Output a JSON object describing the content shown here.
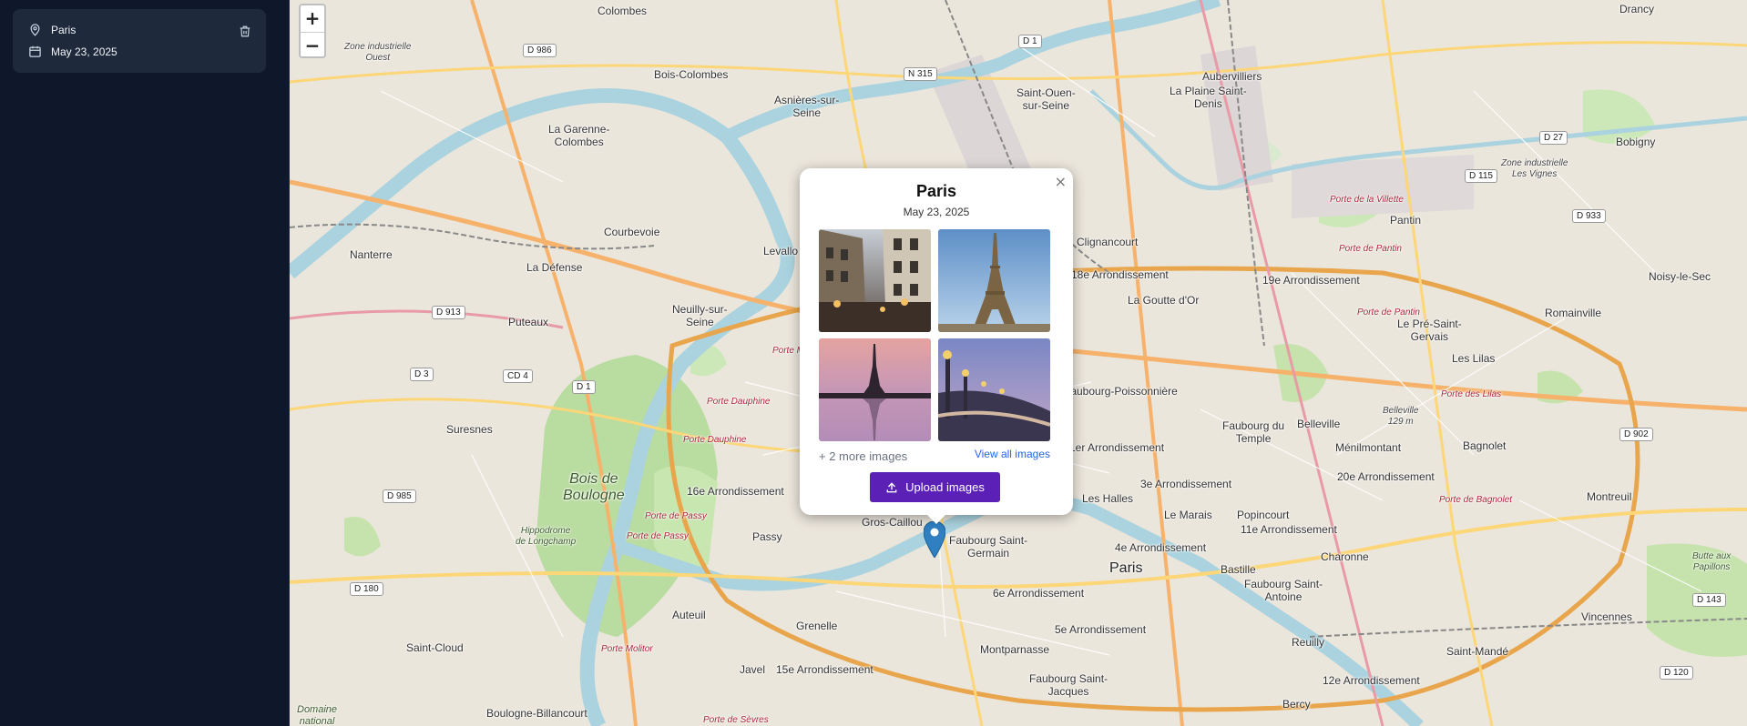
{
  "sidebar": {
    "trip": {
      "location": "Paris",
      "date": "May 23, 2025"
    },
    "icons": {
      "location": "map-pin-icon",
      "date": "calendar-icon",
      "delete": "trash-icon"
    }
  },
  "map": {
    "zoom_in": "+",
    "zoom_out": "−",
    "places": {
      "colombes": "Colombes",
      "bois_colombes": "Bois-Colombes",
      "asnieres": "Asnières-sur-\nSeine",
      "garenne": "La Garenne-\nColombes",
      "courbevoie": "Courbevoie",
      "nanterre": "Nanterre",
      "la_defense": "La Défense",
      "puteaux": "Puteaux",
      "neuilly": "Neuilly-sur-\nSeine",
      "levallois": "Levallo",
      "suresnes": "Suresnes",
      "bois_boulogne": "Bois de\nBoulogne",
      "hippodrome": "Hippodrome\nde Longchamp",
      "arr16": "16e Arrondissement",
      "passy": "Passy",
      "auteuil": "Auteuil",
      "grenelle": "Grenelle",
      "javel": "Javel",
      "arr15": "15e Arrondissement",
      "saint_cloud": "Saint-Cloud",
      "boulogne": "Boulogne-Billancourt",
      "domaine": "Domaine\nnational",
      "saint_ouen": "Saint-Ouen-\nsur-Seine",
      "aubervilliers": "Aubervilliers",
      "plaine_st_denis": "La Plaine Saint-\nDenis",
      "drancy": "Drancy",
      "bobigny": "Bobigny",
      "pantin": "Pantin",
      "noisy": "Noisy-le-Sec",
      "romainville": "Romainville",
      "pre_st_gervais": "Le Pré-Saint-\nGervais",
      "les_lilas": "Les Lilas",
      "bagnolet": "Bagnolet",
      "montreuil": "Montreuil",
      "vincennes": "Vincennes",
      "saint_mande": "Saint-Mandé",
      "clignancourt": "Clignancourt",
      "arr18": "18e Arrondissement",
      "goutte_dor": "La Goutte d'Or",
      "arr19": "19e Arrondissement",
      "fbg_poissonniere": "Faubourg-Poissonnière",
      "fbg_temple": "Faubourg du\nTemple",
      "belleville": "Belleville",
      "menilmontant": "Ménilmontant",
      "arr20": "20e Arrondissement",
      "arr1": "1er Arrondissement",
      "les_halles": "Les Halles",
      "arr3": "3e Arrondissement",
      "le_marais": "Le Marais",
      "popincourt": "Popincourt",
      "arr11": "11e Arrondissement",
      "charonne": "Charonne",
      "arr4": "4e Arrondissement",
      "paris": "Paris",
      "bastille": "Bastille",
      "fbg_st_antoine": "Faubourg Saint-\nAntoine",
      "arr6": "6e Arrondissement",
      "arr5": "5e Arrondissement",
      "montparnasse": "Montparnasse",
      "fbg_st_jacques": "Faubourg Saint-\nJacques",
      "reuilly": "Reuilly",
      "arr12": "12e Arrondissement",
      "bercy": "Bercy",
      "gros_caillou": "Gros-Caillou",
      "fbg_st_germain": "Faubourg Saint-\nGermain",
      "zone_ouest": "Zone industrielle\nOuest",
      "zone_vignes": "Zone industrielle\nLes Vignes",
      "butte": "Butte aux\nPapillons",
      "belleville_alt": "Belleville\n129 m"
    },
    "red_labels": {
      "porte_maillot": "Porte Maillot",
      "porte_dauphine1": "Porte Dauphine",
      "porte_dauphine2": "Porte Dauphine",
      "porte_passy1": "Porte de Passy",
      "porte_passy2": "Porte de Passy",
      "porte_molitor": "Porte Molitor",
      "porte_sevres": "Porte de Sèvres",
      "porte_villette": "Porte de la Villette",
      "porte_pantin1": "Porte de Pantin",
      "porte_pantin2": "Porte de Pantin",
      "porte_lilas": "Porte des Lilas",
      "porte_bagnolet": "Porte de Bagnolet"
    },
    "roads": {
      "d986": "D 986",
      "n315": "N 315",
      "d1a": "D 1",
      "d913": "D 913",
      "d3": "D 3",
      "cd4": "CD 4",
      "d1b": "D 1",
      "d985": "D 985",
      "d180": "D 180",
      "d27": "D 27",
      "d115": "D 115",
      "d933": "D 933",
      "d902": "D 902",
      "d143": "D 143",
      "d120": "D 120"
    }
  },
  "popup": {
    "title": "Paris",
    "date": "May 23, 2025",
    "close": "×",
    "more_images": "+ 2 more images",
    "view_all": "View all images",
    "upload_label": "Upload images",
    "images": [
      "paris-street-photo",
      "eiffel-tower-photo",
      "eiffel-sunset-photo",
      "alexandre-bridge-photo"
    ]
  },
  "colors": {
    "sidebar_bg": "#0f172a",
    "card_bg": "#1e293b",
    "accent": "#5b21b6",
    "link": "#2563eb",
    "marker": "#2f7fc1"
  }
}
